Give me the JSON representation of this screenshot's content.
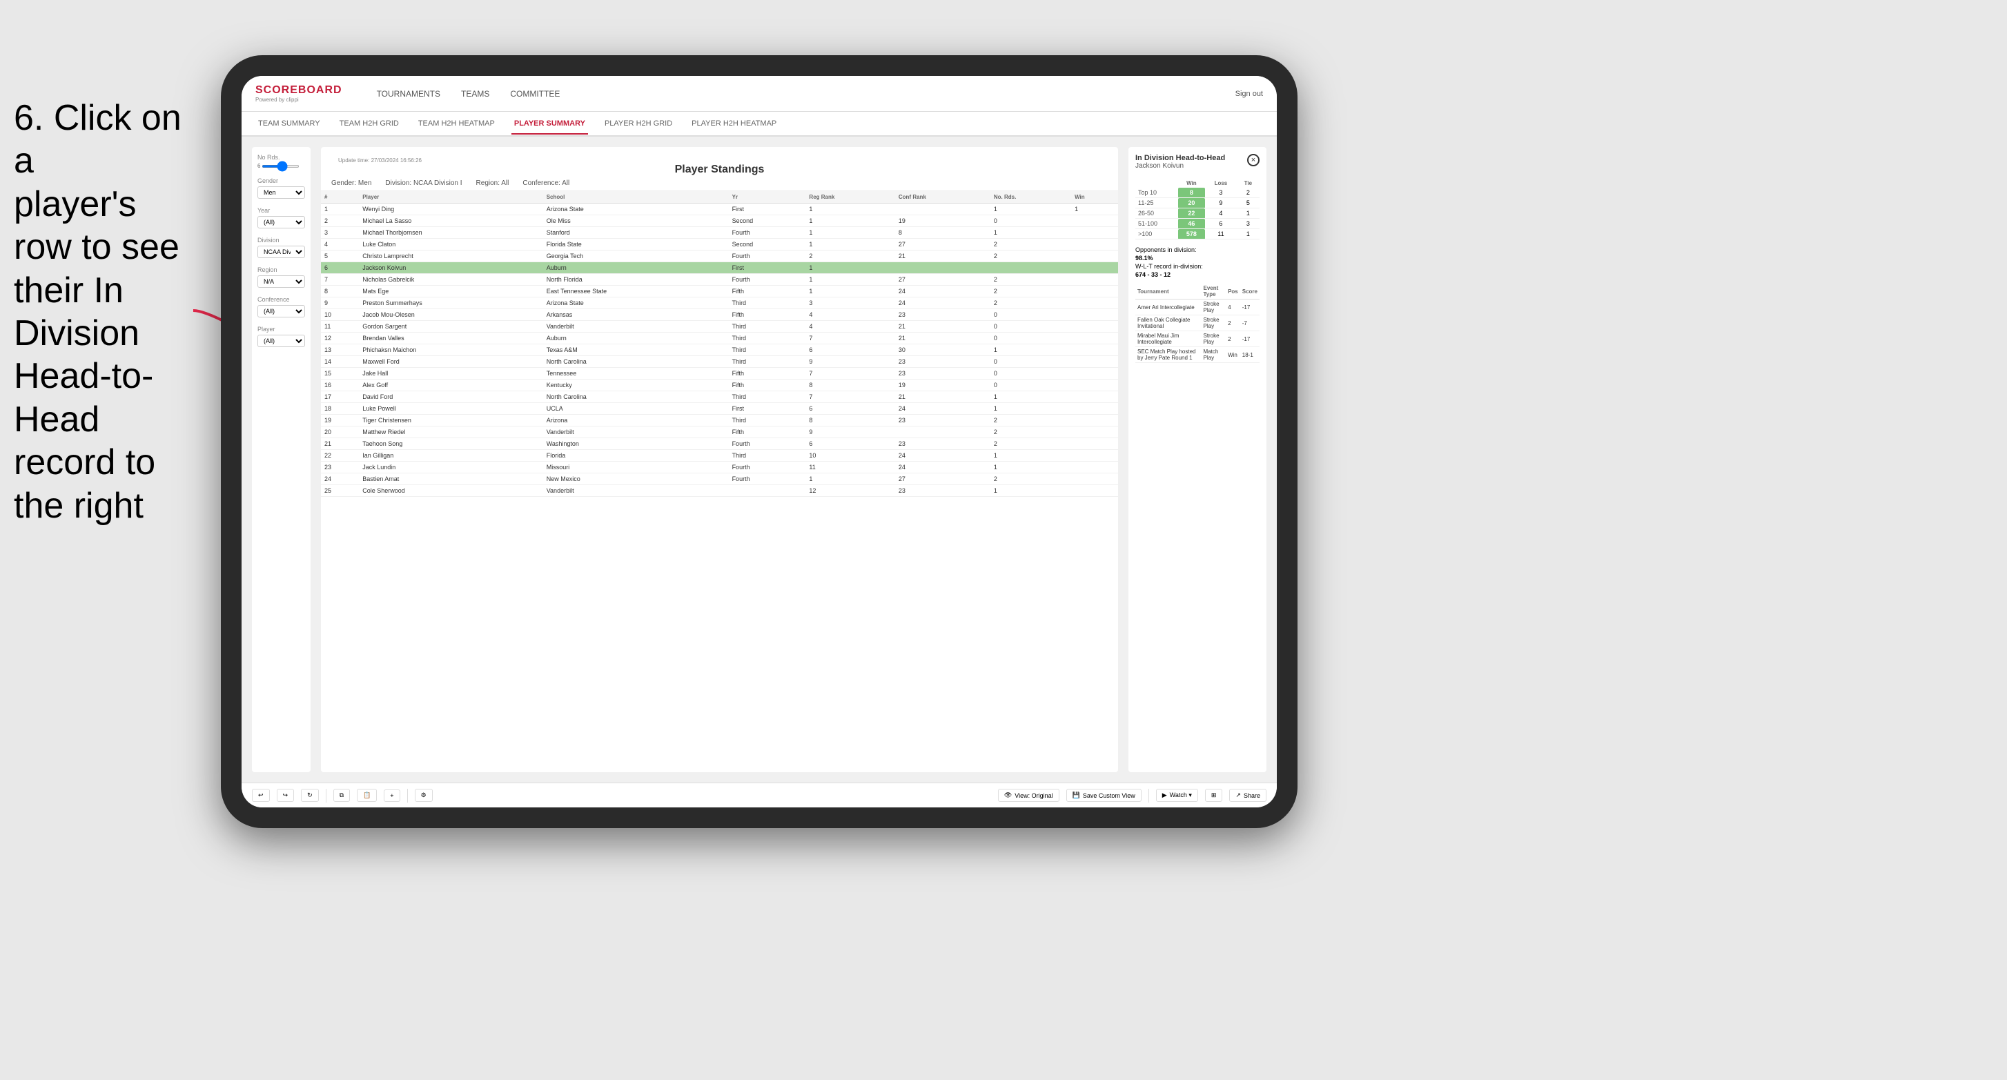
{
  "instruction": {
    "line1": "6. Click on a",
    "line2": "player's row to see",
    "line3": "their In Division",
    "line4": "Head-to-Head",
    "line5": "record to the right"
  },
  "app": {
    "logo": "SCOREBOARD",
    "logo_sub": "Powered by clippi",
    "sign_out": "Sign out"
  },
  "nav": {
    "items": [
      "TOURNAMENTS",
      "TEAMS",
      "COMMITTEE"
    ]
  },
  "sub_nav": {
    "items": [
      "TEAM SUMMARY",
      "TEAM H2H GRID",
      "TEAM H2H HEATMAP",
      "PLAYER SUMMARY",
      "PLAYER H2H GRID",
      "PLAYER H2H HEATMAP"
    ],
    "active": "PLAYER SUMMARY"
  },
  "filters": {
    "no_rds_label": "No Rds.",
    "gender_label": "Gender",
    "gender_value": "Men",
    "year_label": "Year",
    "year_value": "(All)",
    "division_label": "Division",
    "division_value": "NCAA Division I",
    "region_label": "Region",
    "region_value": "N/A",
    "conference_label": "Conference",
    "conference_value": "(All)",
    "player_label": "Player",
    "player_value": "(All)"
  },
  "standings": {
    "title": "Player Standings",
    "update_time": "Update time:",
    "update_date": "27/03/2024 16:56:26",
    "gender_label": "Gender:",
    "gender_value": "Men",
    "division_label": "Division:",
    "division_value": "NCAA Division I",
    "region_label": "Region:",
    "region_value": "All",
    "conference_label": "Conference:",
    "conference_value": "All",
    "columns": [
      "#",
      "Player",
      "School",
      "Yr",
      "Reg Rank",
      "Conf Rank",
      "No. Rds.",
      "Win"
    ],
    "rows": [
      {
        "rank": "1",
        "player": "Wenyi Ding",
        "school": "Arizona State",
        "yr": "First",
        "reg": "1",
        "conf": "",
        "rds": "1",
        "win": "1"
      },
      {
        "rank": "2",
        "player": "Michael La Sasso",
        "school": "Ole Miss",
        "yr": "Second",
        "reg": "1",
        "conf": "19",
        "rds": "0",
        "win": ""
      },
      {
        "rank": "3",
        "player": "Michael Thorbjornsen",
        "school": "Stanford",
        "yr": "Fourth",
        "reg": "1",
        "conf": "8",
        "rds": "1",
        "win": ""
      },
      {
        "rank": "4",
        "player": "Luke Claton",
        "school": "Florida State",
        "yr": "Second",
        "reg": "1",
        "conf": "27",
        "rds": "2",
        "win": ""
      },
      {
        "rank": "5",
        "player": "Christo Lamprecht",
        "school": "Georgia Tech",
        "yr": "Fourth",
        "reg": "2",
        "conf": "21",
        "rds": "2",
        "win": ""
      },
      {
        "rank": "6",
        "player": "Jackson Koivun",
        "school": "Auburn",
        "yr": "First",
        "reg": "1",
        "conf": "",
        "rds": "",
        "win": "",
        "highlighted": true
      },
      {
        "rank": "7",
        "player": "Nicholas Gabrelcik",
        "school": "North Florida",
        "yr": "Fourth",
        "reg": "1",
        "conf": "27",
        "rds": "2",
        "win": ""
      },
      {
        "rank": "8",
        "player": "Mats Ege",
        "school": "East Tennessee State",
        "yr": "Fifth",
        "reg": "1",
        "conf": "24",
        "rds": "2",
        "win": ""
      },
      {
        "rank": "9",
        "player": "Preston Summerhays",
        "school": "Arizona State",
        "yr": "Third",
        "reg": "3",
        "conf": "24",
        "rds": "2",
        "win": ""
      },
      {
        "rank": "10",
        "player": "Jacob Mou-Olesen",
        "school": "Arkansas",
        "yr": "Fifth",
        "reg": "4",
        "conf": "23",
        "rds": "0",
        "win": ""
      },
      {
        "rank": "11",
        "player": "Gordon Sargent",
        "school": "Vanderbilt",
        "yr": "Third",
        "reg": "4",
        "conf": "21",
        "rds": "0",
        "win": ""
      },
      {
        "rank": "12",
        "player": "Brendan Valles",
        "school": "Auburn",
        "yr": "Third",
        "reg": "7",
        "conf": "21",
        "rds": "0",
        "win": ""
      },
      {
        "rank": "13",
        "player": "Phichaksn Maichon",
        "school": "Texas A&M",
        "yr": "Third",
        "reg": "6",
        "conf": "30",
        "rds": "1",
        "win": ""
      },
      {
        "rank": "14",
        "player": "Maxwell Ford",
        "school": "North Carolina",
        "yr": "Third",
        "reg": "9",
        "conf": "23",
        "rds": "0",
        "win": ""
      },
      {
        "rank": "15",
        "player": "Jake Hall",
        "school": "Tennessee",
        "yr": "Fifth",
        "reg": "7",
        "conf": "23",
        "rds": "0",
        "win": ""
      },
      {
        "rank": "16",
        "player": "Alex Goff",
        "school": "Kentucky",
        "yr": "Fifth",
        "reg": "8",
        "conf": "19",
        "rds": "0",
        "win": ""
      },
      {
        "rank": "17",
        "player": "David Ford",
        "school": "North Carolina",
        "yr": "Third",
        "reg": "7",
        "conf": "21",
        "rds": "1",
        "win": ""
      },
      {
        "rank": "18",
        "player": "Luke Powell",
        "school": "UCLA",
        "yr": "First",
        "reg": "6",
        "conf": "24",
        "rds": "1",
        "win": ""
      },
      {
        "rank": "19",
        "player": "Tiger Christensen",
        "school": "Arizona",
        "yr": "Third",
        "reg": "8",
        "conf": "23",
        "rds": "2",
        "win": ""
      },
      {
        "rank": "20",
        "player": "Matthew Riedel",
        "school": "Vanderbilt",
        "yr": "Fifth",
        "reg": "9",
        "conf": "",
        "rds": "2",
        "win": ""
      },
      {
        "rank": "21",
        "player": "Taehoon Song",
        "school": "Washington",
        "yr": "Fourth",
        "reg": "6",
        "conf": "23",
        "rds": "2",
        "win": ""
      },
      {
        "rank": "22",
        "player": "Ian Gilligan",
        "school": "Florida",
        "yr": "Third",
        "reg": "10",
        "conf": "24",
        "rds": "1",
        "win": ""
      },
      {
        "rank": "23",
        "player": "Jack Lundin",
        "school": "Missouri",
        "yr": "Fourth",
        "reg": "11",
        "conf": "24",
        "rds": "1",
        "win": ""
      },
      {
        "rank": "24",
        "player": "Bastien Amat",
        "school": "New Mexico",
        "yr": "Fourth",
        "reg": "1",
        "conf": "27",
        "rds": "2",
        "win": ""
      },
      {
        "rank": "25",
        "player": "Cole Sherwood",
        "school": "Vanderbilt",
        "yr": "",
        "reg": "12",
        "conf": "23",
        "rds": "1",
        "win": ""
      }
    ]
  },
  "h2h": {
    "title": "In Division Head-to-Head",
    "player_name": "Jackson Koivun",
    "close_icon": "×",
    "grid_headers": [
      "",
      "Win",
      "Loss",
      "Tie"
    ],
    "grid_rows": [
      {
        "label": "Top 10",
        "win": "8",
        "loss": "3",
        "tie": "2"
      },
      {
        "label": "11-25",
        "win": "20",
        "loss": "9",
        "tie": "5"
      },
      {
        "label": "26-50",
        "win": "22",
        "loss": "4",
        "tie": "1"
      },
      {
        "label": "51-100",
        "win": "46",
        "loss": "6",
        "tie": "3"
      },
      {
        "label": ">100",
        "win": "578",
        "loss": "11",
        "tie": "1"
      }
    ],
    "opponents_label": "Opponents in division:",
    "wlt_label": "W-L-T record in-division:",
    "opponents_value": "98.1%",
    "wlt_value": "674 - 33 - 12",
    "tournament_columns": [
      "Tournament",
      "Event Type",
      "Pos",
      "Score"
    ],
    "tournaments": [
      {
        "name": "Amer Ari Intercollegiate",
        "type": "Stroke Play",
        "pos": "4",
        "score": "-17"
      },
      {
        "name": "Fallen Oak Collegiate Invitational",
        "type": "Stroke Play",
        "pos": "2",
        "score": "-7"
      },
      {
        "name": "Mirabel Maui Jim Intercollegiate",
        "type": "Stroke Play",
        "pos": "2",
        "score": "-17"
      },
      {
        "name": "SEC Match Play hosted by Jerry Pate Round 1",
        "type": "Match Play",
        "pos": "Win",
        "score": "18-1"
      }
    ]
  },
  "toolbar": {
    "view_original": "View: Original",
    "save_custom": "Save Custom View",
    "watch": "Watch ▾",
    "share": "Share"
  }
}
